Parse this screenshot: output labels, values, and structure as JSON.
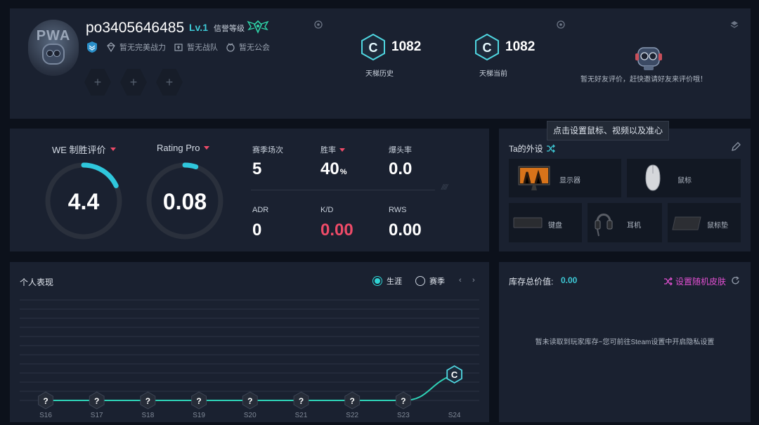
{
  "profile": {
    "avatar_text": "PWA",
    "username": "po3405646485",
    "level": "Lv.1",
    "credit_label": "信誉等级",
    "tags": [
      {
        "icon": "diamond-icon",
        "label": "暂无完美战力"
      },
      {
        "icon": "team-icon",
        "label": "暂无战队"
      },
      {
        "icon": "guild-icon",
        "label": "暂无公会"
      }
    ],
    "slots": [
      "+",
      "+",
      "+"
    ],
    "ladders": [
      {
        "badge": "C",
        "score": "1082",
        "label": "天梯历史"
      },
      {
        "badge": "C",
        "score": "1082",
        "label": "天梯当前"
      }
    ],
    "friend_eval": "暂无好友评价，赶快邀请好友来评价哦！"
  },
  "stats": {
    "gauges": [
      {
        "title": "WE 制胜评价",
        "value": "4.4",
        "fill": 0.18
      },
      {
        "title": "Rating Pro",
        "value": "0.08",
        "fill": 0.05
      }
    ],
    "items": [
      {
        "label": "赛季场次",
        "value": "5",
        "has_caret": false
      },
      {
        "label": "胜率",
        "value": "40",
        "suffix": "%",
        "has_caret": true
      },
      {
        "label": "爆头率",
        "value": "0.0",
        "has_caret": false
      },
      {
        "label": "ADR",
        "value": "0",
        "has_caret": false
      },
      {
        "label": "K/D",
        "value": "0.00",
        "has_caret": false,
        "color": "#ee4b68"
      },
      {
        "label": "RWS",
        "value": "0.00",
        "has_caret": false
      }
    ],
    "slashes": "////"
  },
  "gear": {
    "title": "Ta的外设",
    "tooltip": "点击设置鼠标、视频以及准心",
    "items": [
      {
        "name": "显示器",
        "icon": "monitor-icon"
      },
      {
        "name": "鼠标",
        "icon": "mouse-icon"
      },
      {
        "name": "键盘",
        "icon": "keyboard-icon"
      },
      {
        "name": "耳机",
        "icon": "headset-icon"
      },
      {
        "name": "鼠标垫",
        "icon": "mousepad-icon"
      }
    ]
  },
  "performance": {
    "title": "个人表现",
    "modes": [
      {
        "label": "生涯",
        "selected": true
      },
      {
        "label": "赛季",
        "selected": false
      }
    ],
    "pager_prev": "‹",
    "pager_next": "›"
  },
  "chart_data": {
    "type": "line",
    "categories": [
      "S16",
      "S17",
      "S18",
      "S19",
      "S20",
      "S21",
      "S22",
      "S23",
      "S24"
    ],
    "badges": [
      "?",
      "?",
      "?",
      "?",
      "?",
      "?",
      "?",
      "?",
      "C"
    ],
    "values": [
      0,
      0,
      0,
      0,
      0,
      0,
      0,
      0,
      1
    ],
    "gridlines": 12,
    "line_color": "#2fd4b8"
  },
  "inventory": {
    "label": "库存总价值:",
    "value": "0.00",
    "random_skin": "设置随机皮肤",
    "empty_message": "暂未读取到玩家库存~您可前往Steam设置中开启隐私设置"
  },
  "colors": {
    "accent": "#3ec9d6",
    "danger": "#ee4b68",
    "panel": "#1a2130",
    "background": "#0c111b"
  }
}
